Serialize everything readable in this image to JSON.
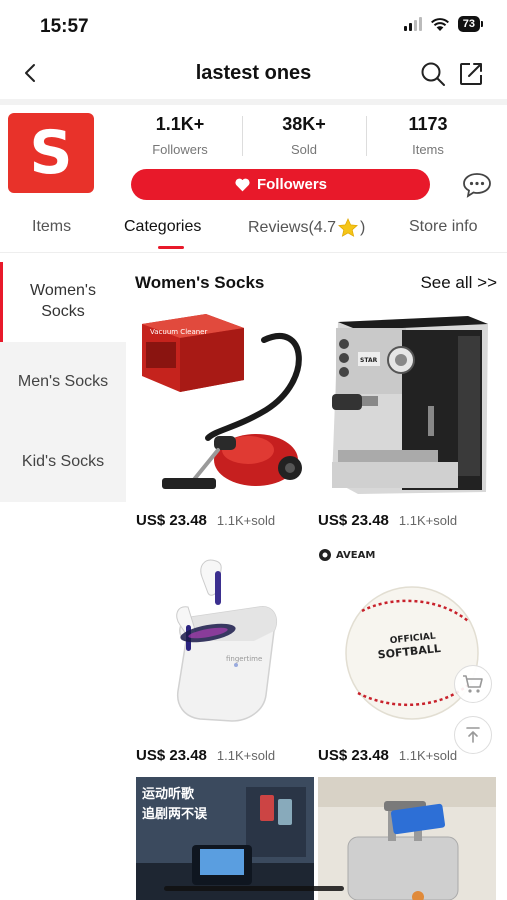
{
  "status_bar": {
    "time": "15:57",
    "battery": "73"
  },
  "nav": {
    "title": "lastest ones",
    "back_icon": "chevron-left-icon",
    "search_icon": "search-icon",
    "share_icon": "share-icon"
  },
  "store": {
    "logo_letter": "S",
    "brand_color": "#e8322a",
    "stats": [
      {
        "value": "1.1K+",
        "label": "Followers"
      },
      {
        "value": "38K+",
        "label": "Sold"
      },
      {
        "value": "1173",
        "label": "Items"
      }
    ],
    "follow_button": "Followers",
    "chat_icon": "chat-bubble-icon"
  },
  "tabs": [
    {
      "label": "Items",
      "active": false
    },
    {
      "label": "Categories",
      "active": true
    },
    {
      "label": "Reviews(4.7",
      "suffix": ")",
      "active": false
    },
    {
      "label": "Store info",
      "active": false
    }
  ],
  "sidebar": {
    "items": [
      {
        "label": "Women's Socks",
        "active": true
      },
      {
        "label": "Men's Socks",
        "active": false
      },
      {
        "label": "Kid's Socks",
        "active": false
      }
    ]
  },
  "section": {
    "title": "Women's Socks",
    "see_all": "See all >>"
  },
  "products": [
    {
      "price": "US$ 23.48",
      "sold": "1.1K+sold",
      "image": "vacuum-cleaner"
    },
    {
      "price": "US$ 23.48",
      "sold": "1.1K+sold",
      "image": "espresso-machine"
    },
    {
      "price": "US$ 23.48",
      "sold": "1.1K+sold",
      "image": "wireless-earbuds"
    },
    {
      "price": "US$ 23.48",
      "sold": "1.1K+sold",
      "image": "softball"
    }
  ],
  "images_text": {
    "softball_line1": "OFFICIAL",
    "softball_line2": "SOFTBALL",
    "brand_mark": "AVEAM",
    "earbuds_brand": "fingertime",
    "banner_line1": "运动听歌",
    "banner_line2": "追剧两不误",
    "coffee_brand": "STAR"
  },
  "accent_color": "#e8192a"
}
